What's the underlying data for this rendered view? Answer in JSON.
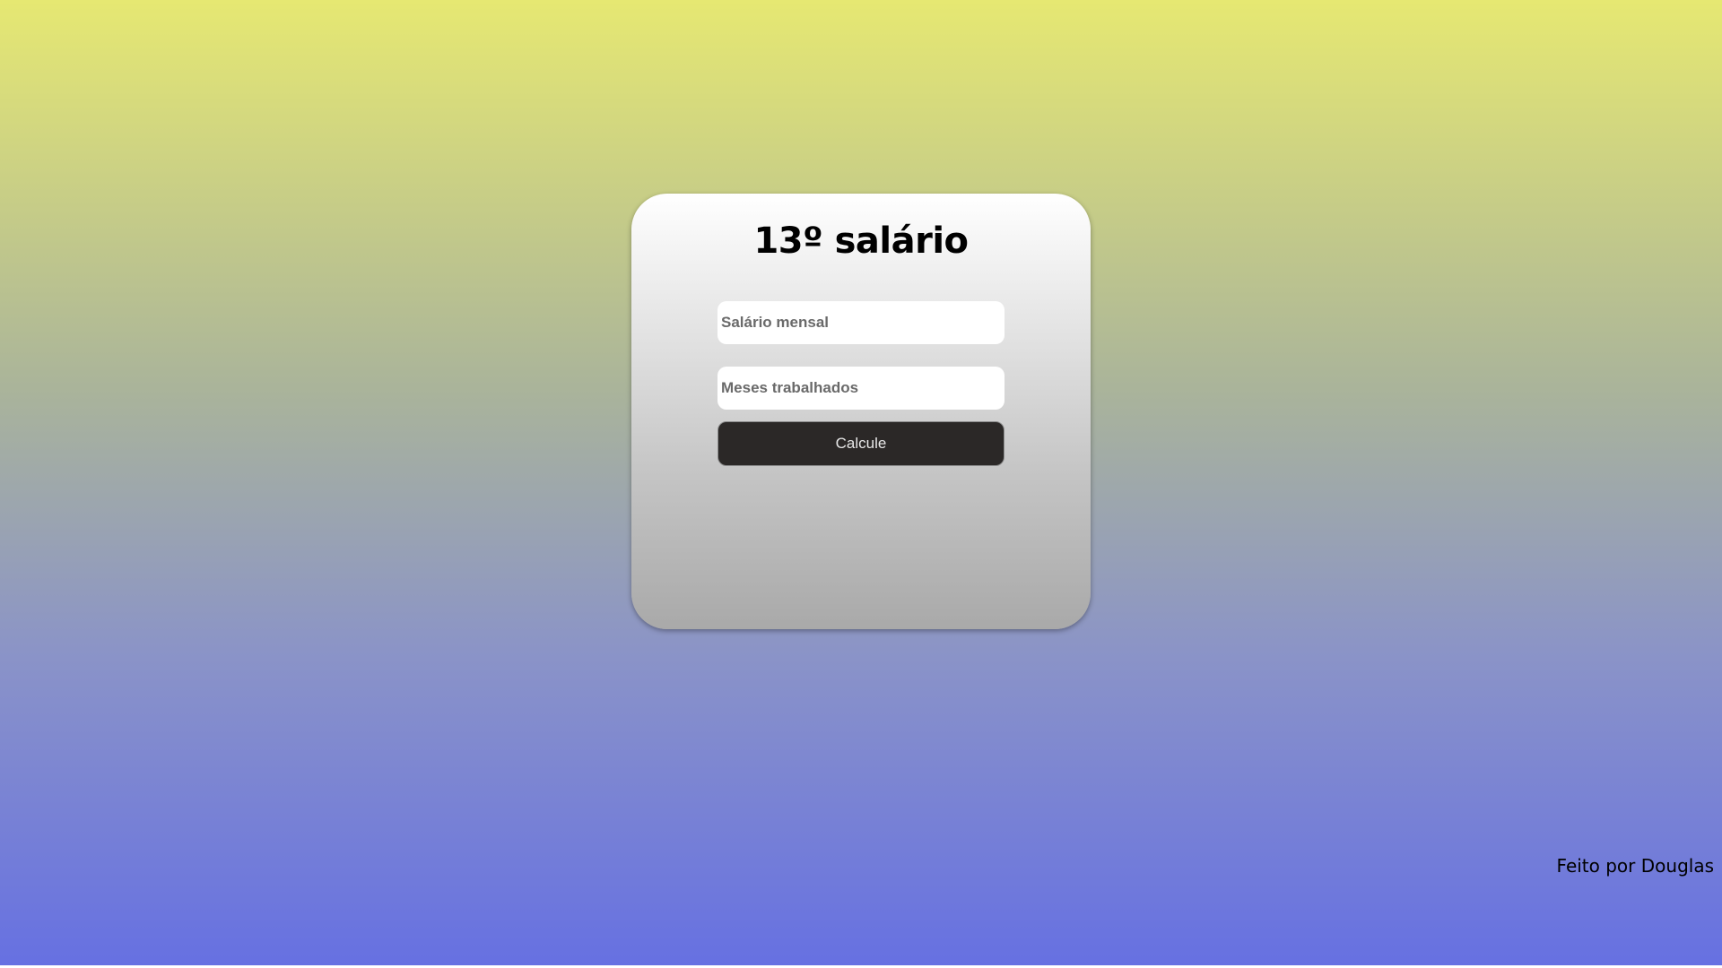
{
  "form": {
    "title": "13º salário",
    "salary_placeholder": "Salário mensal",
    "salary_value": "",
    "months_placeholder": "Meses trabalhados",
    "months_value": "",
    "submit_label": "Calcule"
  },
  "footer": {
    "credit": "Feito por Douglas"
  },
  "colors": {
    "background_top": "#e6e872",
    "background_bottom": "#6670e2",
    "button_bg": "#2b2827",
    "button_text": "#e8e8e8",
    "card_top": "#ffffff",
    "card_bottom": "#a9a9a9"
  }
}
